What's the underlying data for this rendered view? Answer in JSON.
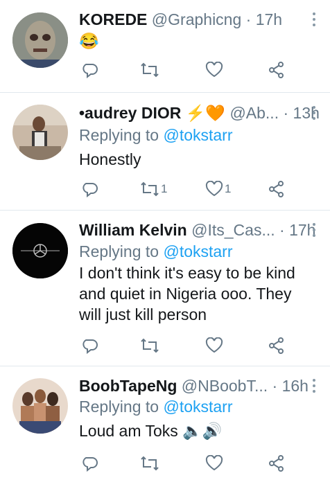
{
  "tweets": [
    {
      "name": "KOREDE",
      "badges": "",
      "handle": "@Graphicng",
      "time": "· 17h",
      "replying_prefix": "",
      "replying_to": "",
      "text": "😂",
      "reply_count": "",
      "retweet_count": "",
      "like_count": "",
      "avatar": "zombie-face-avatar"
    },
    {
      "name": "•audrey DIOR",
      "badges": "⚡🧡",
      "handle": "@Ab...",
      "time": "· 13h",
      "replying_prefix": "Replying to",
      "replying_to": "@tokstarr",
      "text": "Honestly",
      "reply_count": "",
      "retweet_count": "1",
      "like_count": "1",
      "avatar": "person-photo-avatar"
    },
    {
      "name": "William Kelvin",
      "badges": "",
      "handle": "@Its_Cas...",
      "time": "· 17h",
      "replying_prefix": "Replying to",
      "replying_to": "@tokstarr",
      "text": "I don't think it's easy to be kind and quiet in Nigeria ooo. They will just kill person",
      "reply_count": "",
      "retweet_count": "",
      "like_count": "",
      "avatar": "car-logo-avatar"
    },
    {
      "name": "BoobTapeNg",
      "badges": "",
      "handle": "@NBoobT...",
      "time": "· 16h",
      "replying_prefix": "Replying to",
      "replying_to": "@tokstarr",
      "text": "Loud am Toks 🔈🔊",
      "reply_count": "",
      "retweet_count": "",
      "like_count": "",
      "avatar": "group-photo-avatar"
    }
  ],
  "colors": {
    "text": "#14171a",
    "muted": "#657786",
    "accent": "#1da1f2",
    "divider": "#e1e8ed"
  }
}
